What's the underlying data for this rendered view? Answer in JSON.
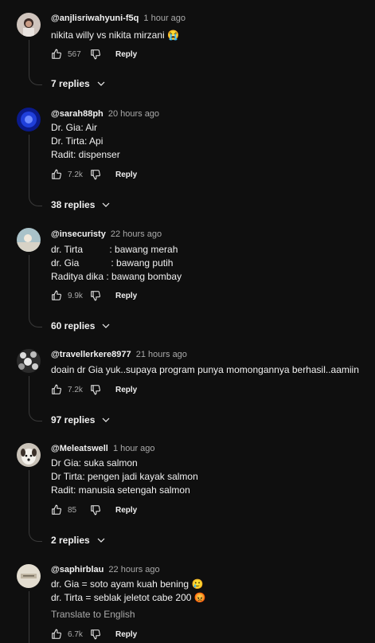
{
  "colors": {
    "background": "#0f0f0f",
    "text": "#f1f1f1",
    "muted": "#aaaaaa"
  },
  "comments": [
    {
      "author": "@anjlisriwahyuni-f5q",
      "time": "1 hour ago",
      "lines": [
        "nikita willy vs nikita mirzani 😭"
      ],
      "likes": "567",
      "reply_label": "Reply",
      "replies_label": "7 replies"
    },
    {
      "author": "@sarah88ph",
      "time": "20 hours ago",
      "lines": [
        "Dr. Gia: Air",
        "Dr. Tirta: Api",
        "Radit: dispenser"
      ],
      "likes": "7.2k",
      "reply_label": "Reply",
      "replies_label": "38 replies"
    },
    {
      "author": "@insecuristy",
      "time": "22 hours ago",
      "lines": [
        "dr. Tirta          : bawang merah",
        "dr. Gia            : bawang putih",
        "Raditya dika : bawang bombay"
      ],
      "likes": "9.9k",
      "reply_label": "Reply",
      "replies_label": "60 replies"
    },
    {
      "author": "@travellerkere8977",
      "time": "21 hours ago",
      "lines": [
        "doain dr Gia yuk..supaya program punya momongannya berhasil..aamiin"
      ],
      "likes": "7.2k",
      "reply_label": "Reply",
      "replies_label": "97 replies"
    },
    {
      "author": "@Meleatswell",
      "time": "1 hour ago",
      "lines": [
        "Dr Gia: suka salmon",
        "Dr Tirta: pengen jadi kayak salmon",
        "Radit: manusia setengah salmon"
      ],
      "likes": "85",
      "reply_label": "Reply",
      "replies_label": "2 replies"
    },
    {
      "author": "@saphirblau",
      "time": "22 hours ago",
      "lines": [
        "dr. Gia = soto ayam kuah bening 🥲",
        "dr. Tirta = seblak jeletot cabe 200 😡"
      ],
      "translate": "Translate to English",
      "likes": "6.7k",
      "reply_label": "Reply"
    }
  ]
}
